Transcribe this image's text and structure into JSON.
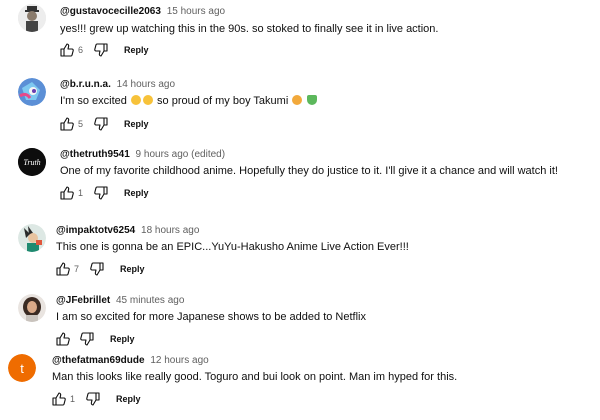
{
  "comments": [
    {
      "handle": "@gustavocecille2063",
      "time": "15 hours ago",
      "text": "yes!!! grew up watching this in the 90s. so stoked to finally see it in live action.",
      "likes": "6",
      "reply": "Reply"
    },
    {
      "handle": "@b.r.u.n.a.",
      "time": "14 hours ago",
      "text_before": "I'm so excited",
      "text_middle": "so proud of my boy Takumi",
      "likes": "5",
      "reply": "Reply",
      "emojis": [
        "crying-face-emoji",
        "crying-face-emoji",
        "smiling-face-with-hearts-emoji",
        "green-heart-emoji"
      ]
    },
    {
      "handle": "@thetruth9541",
      "time": "9 hours ago (edited)",
      "text": "One of my favorite childhood anime. Hopefully they do justice to it. I'll give it a chance and will watch it!",
      "likes": "1",
      "reply": "Reply",
      "avatar_text": "Truth"
    },
    {
      "handle": "@impaktotv6254",
      "time": "18 hours ago",
      "text": "This one is gonna be an EPIC...YuYu-Hakusho Anime Live Action Ever!!!",
      "likes": "7",
      "reply": "Reply"
    },
    {
      "handle": "@JFebrillet",
      "time": "45 minutes ago",
      "text": "I am so excited for more Japanese shows to be added to Netflix",
      "likes": "",
      "reply": "Reply"
    },
    {
      "handle": "@thefatman69dude",
      "time": "12 hours ago",
      "text": "Man this looks like really good. Toguro and bui look on point. Man im hyped for this.",
      "likes": "1",
      "reply": "Reply",
      "avatar_letter": "t"
    }
  ],
  "colors": {
    "handle": "#0f0f0f",
    "meta": "#606060",
    "avatar_orange": "#ef6c00"
  }
}
